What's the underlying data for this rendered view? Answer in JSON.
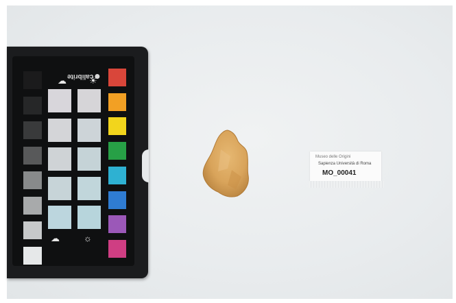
{
  "checker": {
    "brand": "calibrite",
    "gray_column": [
      "#1b1b1c",
      "#262728",
      "#393a3b",
      "#58595a",
      "#888a8b",
      "#a8aaab",
      "#c7c9ca",
      "#e6e8e9"
    ],
    "swatch_column_1": [
      "#d8d6db",
      "#d4d5d8",
      "#cfd3d6",
      "#c7d4d8",
      "#bcd6de"
    ],
    "swatch_column_2": [
      "#d6d5d8",
      "#cdd4d8",
      "#c5d3d7",
      "#c1d6db",
      "#b7d5dc"
    ],
    "color_column": [
      "#d9463a",
      "#f2a024",
      "#f2d51c",
      "#27a046",
      "#2eb1d2",
      "#2f7cd2",
      "#9b58b8",
      "#cf3e83"
    ]
  },
  "label": {
    "line1": "Museo delle Origini",
    "line2": "Sapienza  Università di Roma",
    "id": "MO_00041"
  }
}
